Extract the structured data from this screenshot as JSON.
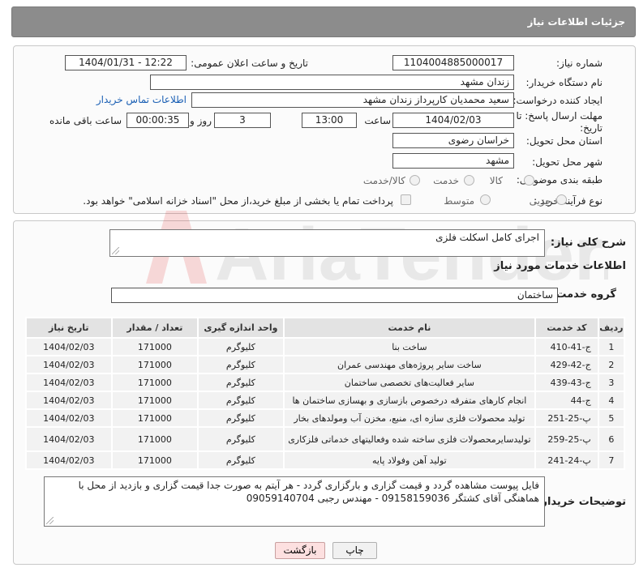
{
  "header": {
    "title": "جزئیات اطلاعات نیاز"
  },
  "form": {
    "need_number": {
      "label": "شماره نیاز:",
      "value": "1104004885000017"
    },
    "announce_datetime": {
      "label": "تاریخ و ساعت اعلان عمومی:",
      "value": "1404/01/31 - 12:22"
    },
    "buyer_org": {
      "label": "نام دستگاه خریدار:",
      "value": "زندان مشهد"
    },
    "requester": {
      "label": "ایجاد کننده درخواست:",
      "value": "سعید محمدیان کارپرداز زندان مشهد",
      "contact_link": "اطلاعات تماس خریدار"
    },
    "deadline": {
      "label_line1": "مهلت ارسال پاسخ: تا",
      "label_line2": "تاریخ:",
      "date": "1404/02/03",
      "time_label": "ساعت",
      "time": "13:00",
      "days": "3",
      "days_label": "روز و",
      "remaining": "00:00:35",
      "remaining_label": "ساعت باقی مانده"
    },
    "province": {
      "label": "استان محل تحویل:",
      "value": "خراسان رضوی"
    },
    "city": {
      "label": "شهر محل تحویل:",
      "value": "مشهد"
    },
    "category": {
      "label": "طبقه بندی موضوعی:",
      "options": [
        "کالا",
        "خدمت",
        "کالا/خدمت"
      ]
    },
    "purchase_type": {
      "label": "نوع فرآیند خرید :",
      "options": [
        "جزیی",
        "متوسط"
      ],
      "treasury_note": "پرداخت تمام یا بخشی از مبلغ خرید،از محل \"اسناد خزانه اسلامی\" خواهد بود."
    }
  },
  "summary": {
    "label": "شرح کلی نیاز:",
    "value": "اجرای کامل اسکلت فلزی"
  },
  "services": {
    "title": "اطلاعات خدمات مورد نیاز",
    "group_label": "گروه خدمت:",
    "group_value": "ساختمان",
    "columns": [
      "ردیف",
      "کد خدمت",
      "نام خدمت",
      "واحد اندازه گیری",
      "تعداد / مقدار",
      "تاریخ نیاز"
    ],
    "rows": [
      {
        "idx": "1",
        "code": "ج-41-410",
        "name": "ساخت بنا",
        "unit": "کلیوگرم",
        "qty": "171000",
        "date": "1404/02/03"
      },
      {
        "idx": "2",
        "code": "ج-42-429",
        "name": "ساخت سایر پروژه‌های مهندسی عمران",
        "unit": "کلیوگرم",
        "qty": "171000",
        "date": "1404/02/03"
      },
      {
        "idx": "3",
        "code": "ج-43-439",
        "name": "سایر فعالیت‌های تخصصی ساختمان",
        "unit": "کلیوگرم",
        "qty": "171000",
        "date": "1404/02/03"
      },
      {
        "idx": "4",
        "code": "ج-44",
        "name": "انجام کارهای متفرقه درخصوص بازسازی و بهسازی ساختمان ها",
        "unit": "کلیوگرم",
        "qty": "171000",
        "date": "1404/02/03"
      },
      {
        "idx": "5",
        "code": "پ-25-251",
        "name": "تولید محصولات فلزی سازه ای، منبع، مخزن آب ومولدهای بخار",
        "unit": "کلیوگرم",
        "qty": "171000",
        "date": "1404/02/03"
      },
      {
        "idx": "6",
        "code": "پ-25-259",
        "name": "تولیدسایرمحصولات فلزی ساخته شده وفعالیتهای خدماتی فلزکاری",
        "unit": "کلیوگرم",
        "qty": "171000",
        "date": "1404/02/03"
      },
      {
        "idx": "7",
        "code": "پ-24-241",
        "name": "تولید آهن وفولاد پایه",
        "unit": "کلیوگرم",
        "qty": "171000",
        "date": "1404/02/03"
      }
    ]
  },
  "buyer_notes": {
    "label": "توضیحات خریدار:",
    "value": "فایل پیوست مشاهده گردد و قیمت گزاری و بارگزاری گردد - هر آیتم به صورت جدا قیمت گزاری و بازدید از محل با هماهنگی آقای کشتگر  09158159036 -   مهندس رجبی 09059140704"
  },
  "buttons": {
    "print": "چاپ",
    "back": "بازگشت"
  },
  "watermark": {
    "text": "AriaTender.neT"
  }
}
